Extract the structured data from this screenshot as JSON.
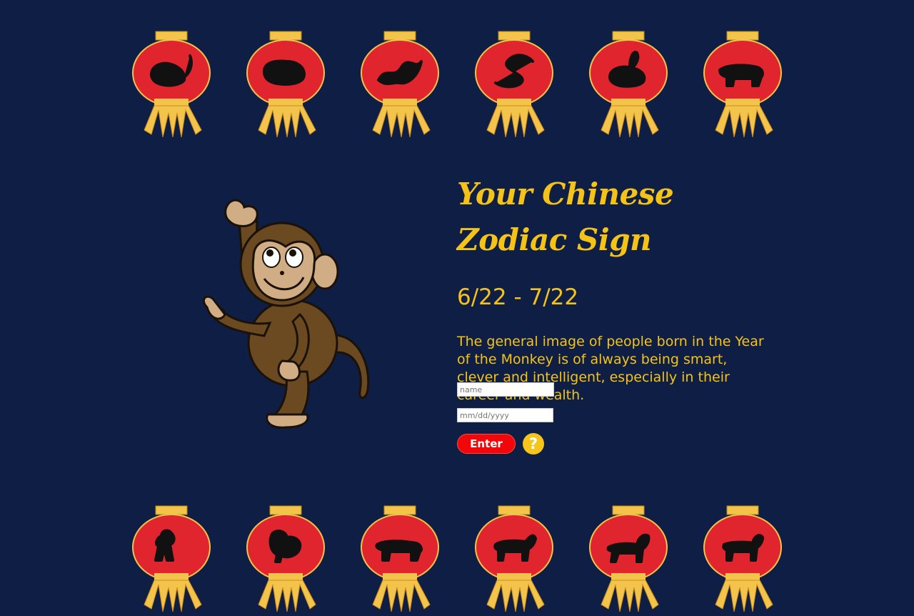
{
  "page": {
    "title": "Your Chinese Zodiac Sign",
    "date_range": "6/22 - 7/22",
    "description": "The general image of people born in the Year of the Monkey is of always being smart, clever and intelligent, especially in their career and wealth.",
    "featured_animal": "monkey-icon"
  },
  "form": {
    "name_placeholder": "name",
    "date_placeholder": "mm/dd/yyyy",
    "enter_label": "Enter",
    "help_label": "?"
  },
  "lanterns_top": [
    "rat-icon",
    "pig-icon",
    "dragon-icon",
    "snake-icon",
    "rabbit-icon",
    "ox-icon"
  ],
  "lanterns_bottom": [
    "monkey-icon",
    "rooster-icon",
    "tiger-icon",
    "goat-icon",
    "horse-icon",
    "dog-icon"
  ],
  "colors": {
    "background": "#0f1e45",
    "accent_text": "#f5c318",
    "lantern_red": "#e0252e",
    "lantern_gold": "#f2c44b",
    "enter_button": "#f1070a",
    "help_button": "#f6c51c"
  }
}
